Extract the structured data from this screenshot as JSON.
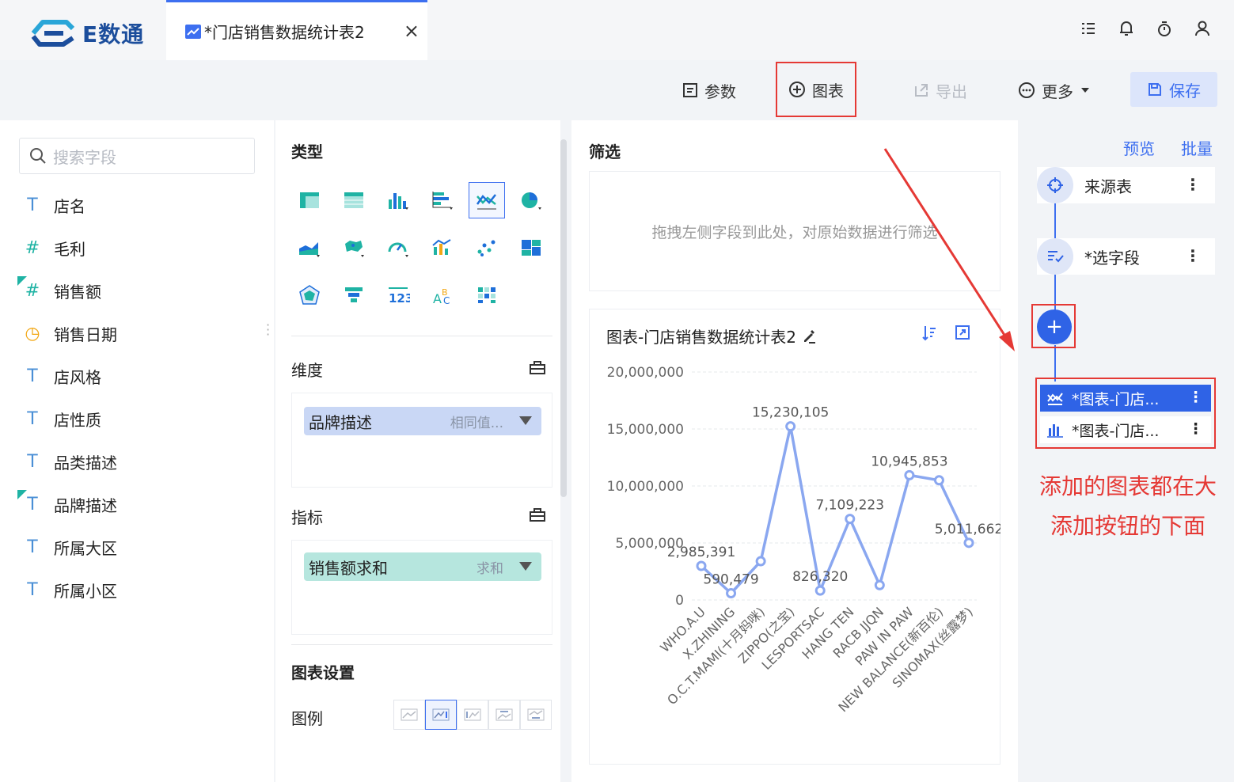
{
  "app": {
    "logo_text": "E数通",
    "tab_title": "*门店销售数据统计表2",
    "tab_close": "×"
  },
  "toolbar": {
    "params": "参数",
    "chart": "图表",
    "export": "导出",
    "more": "更多",
    "save": "保存"
  },
  "fields": {
    "search_placeholder": "搜索字段",
    "items": [
      {
        "type": "T",
        "name": "店名"
      },
      {
        "type": "#",
        "name": "毛利"
      },
      {
        "type": "#",
        "name": "销售额"
      },
      {
        "type": "◷",
        "name": "销售日期"
      },
      {
        "type": "T",
        "name": "店风格"
      },
      {
        "type": "T",
        "name": "店性质"
      },
      {
        "type": "T",
        "name": "品类描述"
      },
      {
        "type": "T",
        "name": "品牌描述"
      },
      {
        "type": "T",
        "name": "所属大区"
      },
      {
        "type": "T",
        "name": "所属小区"
      }
    ]
  },
  "config": {
    "type_title": "类型",
    "dimension_label": "维度",
    "dimension_pill": "品牌描述",
    "dimension_sub": "相同值...",
    "metric_label": "指标",
    "metric_pill": "销售额求和",
    "metric_sub": "求和",
    "chart_settings": "图表设置",
    "legend_label": "图例"
  },
  "filter": {
    "title": "筛选",
    "placeholder": "拖拽左侧字段到此处，对原始数据进行筛选"
  },
  "chart_panel": {
    "title": "图表-门店销售数据统计表2"
  },
  "chart_data": {
    "type": "line",
    "categories": [
      "WHO.A.U",
      "X.ZHINING",
      "O.C.T.MAMI(十月妈咪)",
      "ZIPPO(之宝)",
      "LESPORTSAC",
      "HANG TEN",
      "RACB JJQN",
      "PAW IN PAW",
      "NEW BALANCE(新百伦)",
      "SINOMAX(丝露梦)"
    ],
    "values": [
      2985391,
      590479,
      3400000,
      15230105,
      826320,
      7109223,
      1300000,
      10945853,
      10500000,
      5011662
    ],
    "labels": [
      "2,985,391",
      "590,479",
      "",
      "15,230,105",
      "826,320",
      "7,109,223",
      "",
      "10,945,853",
      "",
      "5,011,662"
    ],
    "yticks": [
      "20,000,000",
      "15,000,000",
      "10,000,000",
      "5,000,000",
      "0"
    ],
    "ylim": [
      0,
      20000000
    ],
    "color": "#8aa7f0"
  },
  "flow": {
    "preview": "预览",
    "batch": "批量",
    "source_node": "来源表",
    "select_node": "*选字段",
    "add": "+",
    "chart_node_1": "*图表-门店...",
    "chart_node_2": "*图表-门店...",
    "note_line1": "添加的图表都在大",
    "note_line2": "添加按钮的下面"
  },
  "colors": {
    "accent": "#3d6ff0",
    "annotation": "#e53935"
  }
}
